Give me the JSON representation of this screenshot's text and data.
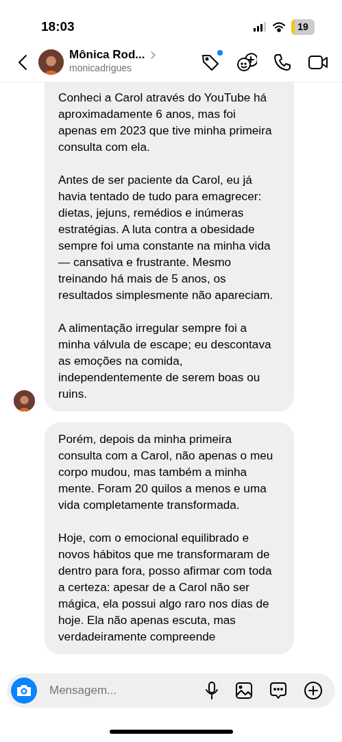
{
  "status_bar": {
    "time": "18:03",
    "battery": "19"
  },
  "header": {
    "name": "Mônica Rod...",
    "username": "monicadrigues",
    "tag_unread": true
  },
  "messages": [
    {
      "show_avatar": true,
      "paragraphs": [
        "Conheci a Carol através do YouTube há aproximadamente 6 anos, mas foi apenas em 2023 que tive minha primeira consulta com ela.",
        "Antes de ser paciente da Carol, eu já havia tentado de tudo para emagrecer: dietas, jejuns, remédios e inúmeras estratégias. A luta contra a obesidade sempre foi uma constante na minha vida — cansativa e frustrante. Mesmo treinando há mais de 5 anos, os resultados simplesmente não apareciam.",
        "A alimentação irregular sempre foi a minha válvula de escape; eu descontava as emoções na comida, independentemente de serem boas ou ruins."
      ]
    },
    {
      "show_avatar": false,
      "paragraphs": [
        "Porém, depois da minha primeira consulta com a Carol, não apenas o meu corpo mudou, mas também a minha mente. Foram 20 quilos a menos e uma vida completamente transformada.",
        "Hoje, com o emocional equilibrado e novos hábitos que me transformaram de dentro para fora, posso afirmar com toda a certeza: apesar de a Carol não ser mágica, ela possui algo raro nos dias de hoje. Ela não apenas escuta, mas verdadeiramente compreende"
      ]
    }
  ],
  "composer": {
    "placeholder": "Mensagem..."
  }
}
